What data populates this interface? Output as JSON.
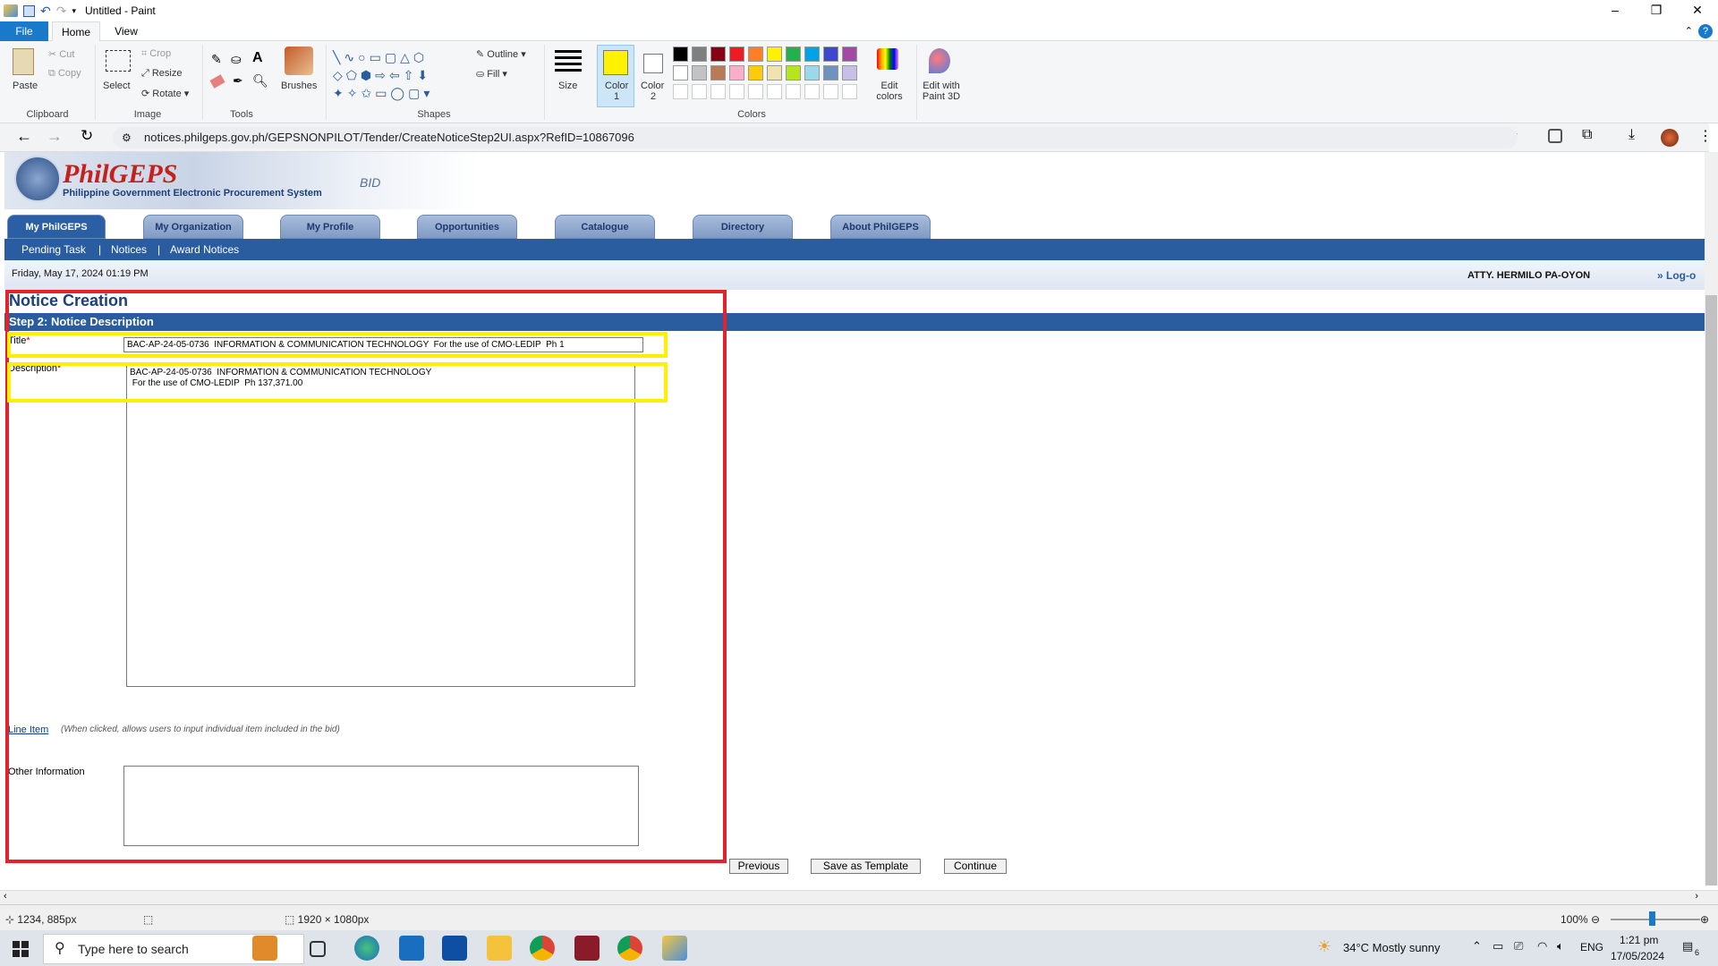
{
  "paint": {
    "window_title": "Untitled - Paint",
    "tabs": [
      "File",
      "Home",
      "View"
    ],
    "clipboard": {
      "paste": "Paste",
      "cut": "Cut",
      "copy": "Copy",
      "group": "Clipboard"
    },
    "image": {
      "select": "Select",
      "crop": "Crop",
      "resize": "Resize",
      "rotate": "Rotate",
      "group": "Image"
    },
    "tools": {
      "group": "Tools",
      "brushes": "Brushes"
    },
    "shapes": {
      "outline": "Outline",
      "fill": "Fill",
      "group": "Shapes"
    },
    "size_label": "Size",
    "color1_label": "Color",
    "color1_num": "1",
    "color2_label": "Color",
    "color2_num": "2",
    "colors_group": "Colors",
    "edit_colors": "Edit colors",
    "edit_paint3d": "Edit with Paint 3D",
    "palette": [
      "#000000",
      "#7f7f7f",
      "#880015",
      "#ed1c24",
      "#ff7f27",
      "#fff200",
      "#22b14c",
      "#00a2e8",
      "#3f48cc",
      "#a349a4",
      "#ffffff",
      "#c3c3c3",
      "#b97a57",
      "#ffaec9",
      "#ffc90e",
      "#efe4b0",
      "#b5e61d",
      "#99d9ea",
      "#7092be",
      "#c8bfe7"
    ],
    "color1": "#fff200",
    "status_pos": "1234, 885px",
    "status_size": "1920 × 1080px",
    "zoom": "100%"
  },
  "browser": {
    "url": "notices.philgeps.gov.ph/GEPSNONPILOT/Tender/CreateNoticeStep2UI.aspx?RefID=10867096"
  },
  "site": {
    "logo": "PhilGEPS",
    "logo_sub": "Philippine Government Electronic Procurement System",
    "bid_tag": "BID",
    "nav_tabs": [
      "My PhilGEPS",
      "My Organization",
      "My Profile",
      "Opportunities",
      "Catalogue",
      "Directory",
      "About PhilGEPS"
    ],
    "subnav": [
      "Pending Task",
      "|",
      "Notices",
      "|",
      "Award Notices"
    ],
    "date": "Friday, May 17, 2024 01:19 PM",
    "user": "ATTY. HERMILO PA-OYON",
    "logout": "» Log-o",
    "page_title": "Notice Creation",
    "step_title": "Step 2: Notice Description",
    "form": {
      "title_label": "Title",
      "title_value": "BAC-AP-24-05-0736  INFORMATION & COMMUNICATION TECHNOLOGY  For the use of CMO-LEDIP  Ph 1",
      "description_label": "Description",
      "description_value": "BAC-AP-24-05-0736  INFORMATION & COMMUNICATION TECHNOLOGY\n For the use of CMO-LEDIP  Ph 137,371.00",
      "required_mark": "*",
      "line_item": "Line Item",
      "line_item_note": "(When clicked, allows users to input individual item included in the bid)",
      "other_info_label": "Other Information",
      "other_info_value": ""
    },
    "buttons": {
      "previous": "Previous",
      "save_template": "Save as Template",
      "continue": "Continue"
    }
  },
  "taskbar": {
    "search_placeholder": "Type here to search",
    "weather": "34°C  Mostly sunny",
    "lang": "ENG",
    "time": "1:21 pm",
    "date": "17/05/2024",
    "notif_count": "6"
  }
}
